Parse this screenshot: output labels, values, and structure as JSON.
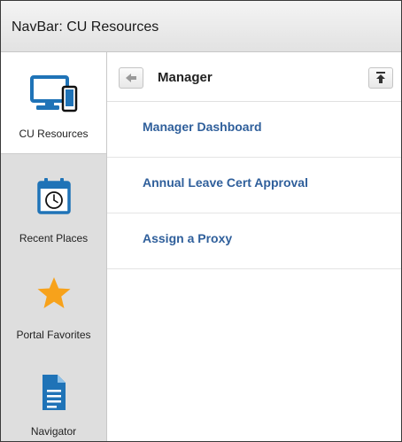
{
  "window": {
    "title": "NavBar: CU Resources"
  },
  "sidebar": {
    "items": [
      {
        "label": "CU Resources",
        "icon": "devices-icon",
        "active": true
      },
      {
        "label": "Recent Places",
        "icon": "calendar-clock-icon",
        "active": false
      },
      {
        "label": "Portal Favorites",
        "icon": "star-icon",
        "active": false
      },
      {
        "label": "Navigator",
        "icon": "document-icon",
        "active": false
      }
    ]
  },
  "main": {
    "header": {
      "title": "Manager",
      "back_icon": "arrow-left-icon",
      "top_icon": "arrow-up-to-top-icon"
    },
    "menu": [
      {
        "label": "Manager Dashboard"
      },
      {
        "label": "Annual Leave Cert Approval"
      },
      {
        "label": "Assign a Proxy"
      }
    ]
  },
  "colors": {
    "link": "#2f5f9b",
    "icon_blue": "#1f73b7",
    "star": "#f7a21b",
    "sidebar_bg": "#dedede"
  }
}
